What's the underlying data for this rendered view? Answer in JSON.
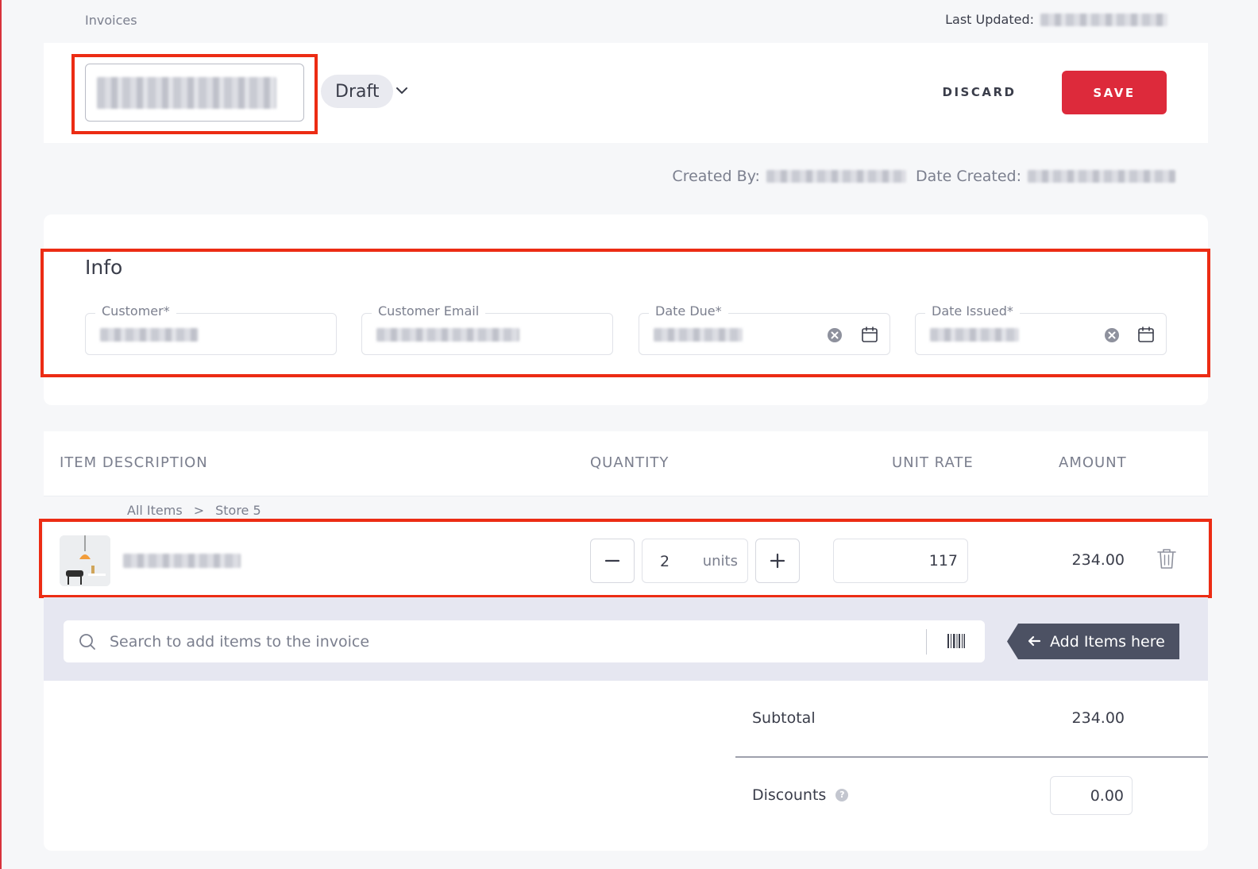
{
  "breadcrumb": {
    "label": "Invoices"
  },
  "last_updated": {
    "label": "Last Updated:"
  },
  "header": {
    "status": "Draft",
    "discard_label": "DISCARD",
    "save_label": "SAVE"
  },
  "meta": {
    "created_by_label": "Created By:",
    "date_created_label": "Date Created:"
  },
  "info": {
    "title": "Info",
    "fields": [
      {
        "label": "Customer*"
      },
      {
        "label": "Customer Email"
      },
      {
        "label": "Date Due*"
      },
      {
        "label": "Date Issued*"
      }
    ]
  },
  "items_table": {
    "columns": [
      "ITEM DESCRIPTION",
      "QUANTITY",
      "UNIT RATE",
      "AMOUNT"
    ],
    "breadcrumb": [
      "All Items",
      ">",
      "Store 5"
    ],
    "rows": [
      {
        "quantity": "2",
        "unit": "units",
        "unit_rate": "117",
        "amount": "234.00"
      }
    ]
  },
  "search": {
    "placeholder": "Search to add items to the invoice",
    "hint": "Add Items here"
  },
  "totals": {
    "subtotal_label": "Subtotal",
    "subtotal_value": "234.00",
    "discounts_label": "Discounts",
    "discounts_value": "0.00",
    "help_glyph": "?"
  },
  "colors": {
    "accent": "#dd2a3b",
    "highlight": "#ec2c14",
    "hint_bg": "#4c5163"
  }
}
